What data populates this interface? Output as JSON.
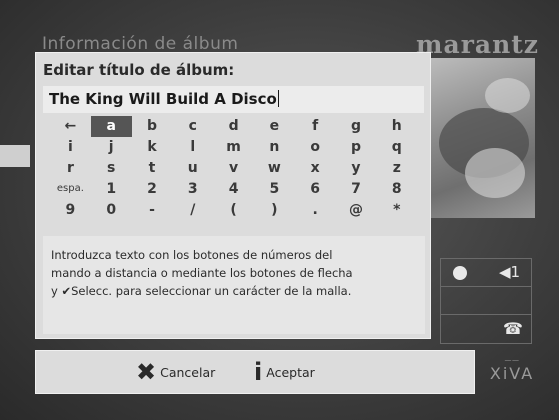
{
  "background": {
    "title": "Información de álbum",
    "brand": "marantz"
  },
  "dialog": {
    "title": "Editar título de álbum:",
    "input_value": "The King Will Build A Disco",
    "keyboard": {
      "selected_key": "a",
      "rows": [
        [
          "←",
          "a",
          "b",
          "c",
          "d",
          "e",
          "f",
          "g",
          "h"
        ],
        [
          "i",
          "j",
          "k",
          "l",
          "m",
          "n",
          "o",
          "p",
          "q"
        ],
        [
          "r",
          "s",
          "t",
          "u",
          "v",
          "w",
          "x",
          "y",
          "z"
        ],
        [
          "espa.",
          "1",
          "2",
          "3",
          "4",
          "5",
          "6",
          "7",
          "8"
        ],
        [
          "9",
          "0",
          "-",
          "/",
          "(",
          ")",
          ".",
          "@",
          "*"
        ]
      ]
    },
    "hint": {
      "line1": "Introduzca texto con los botones de números del",
      "line2": "mando a distancia o mediante los botones de flecha",
      "line3_check": "✔",
      "line3": "y ",
      "line3_bold": "Selecc.",
      "line3_rest": " para seleccionar un carácter de la malla."
    }
  },
  "buttons": {
    "cancel_icon": "✖",
    "cancel_label": "Cancelar",
    "accept_icon": "i",
    "accept_label": "Aceptar"
  },
  "side_panel": {
    "volume_icon": "◀1",
    "phone_icon": "☎"
  },
  "xiva": {
    "small_text": "——",
    "label": "XiVA"
  },
  "colors": {
    "dialog_bg": "#dcdcdc",
    "selected_key_bg": "#555555",
    "screen_bg": "#3e3e3e"
  }
}
